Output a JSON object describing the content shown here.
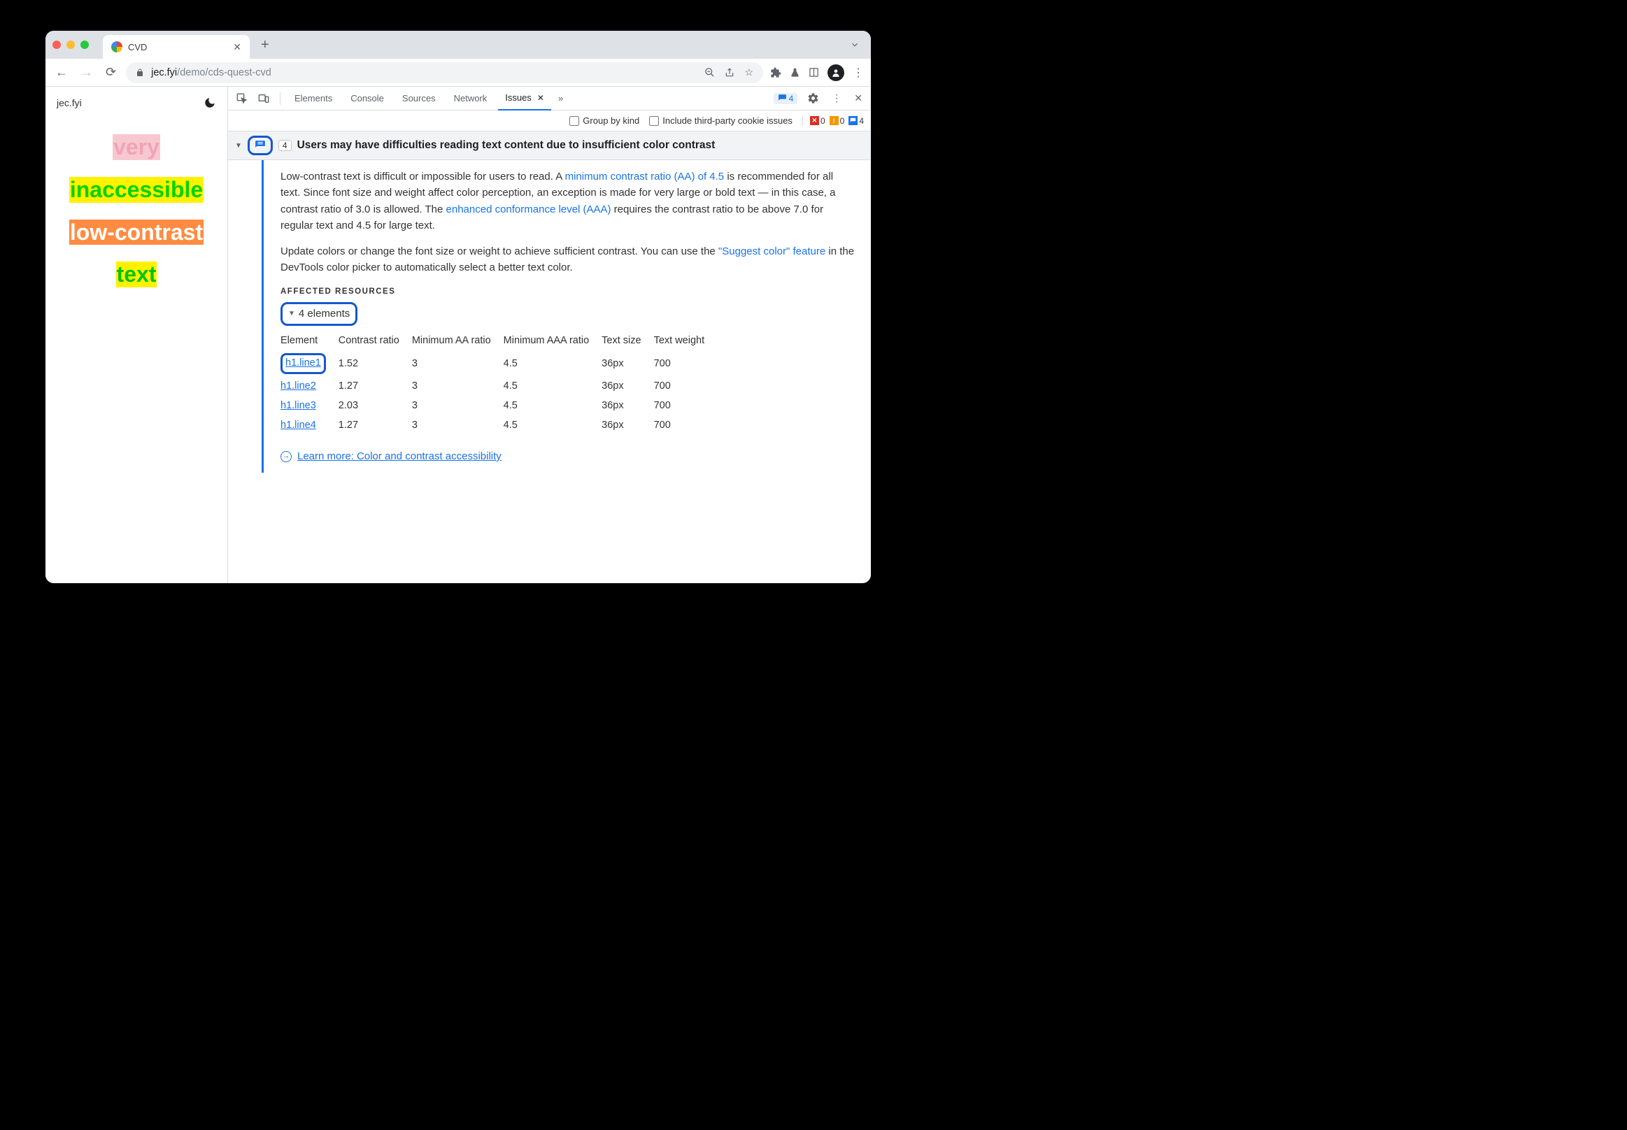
{
  "tab": {
    "title": "CVD"
  },
  "url": {
    "host": "jec.fyi",
    "path": "/demo/cds-quest-cvd"
  },
  "page": {
    "siteLabel": "jec.fyi",
    "samples": [
      "very",
      "inaccessible",
      "low-contrast",
      "text"
    ]
  },
  "devtools": {
    "tabs": [
      "Elements",
      "Console",
      "Sources",
      "Network",
      "Issues"
    ],
    "activeTab": "Issues",
    "msgBadge": "4",
    "filters": {
      "groupByKind": "Group by kind",
      "thirdParty": "Include third-party cookie issues"
    },
    "counts": {
      "errors": "0",
      "warnings": "0",
      "info": "4"
    }
  },
  "issue": {
    "count": "4",
    "title": "Users may have difficulties reading text content due to insufficient color contrast",
    "p1a": "Low-contrast text is difficult or impossible for users to read. A ",
    "p1link1": "minimum contrast ratio (AA) of 4.5",
    "p1b": " is recommended for all text. Since font size and weight affect color perception, an exception is made for very large or bold text — in this case, a contrast ratio of 3.0 is allowed. The ",
    "p1link2": "enhanced conformance level (AAA)",
    "p1c": " requires the contrast ratio to be above 7.0 for regular text and 4.5 for large text.",
    "p2a": "Update colors or change the font size or weight to achieve sufficient contrast. You can use the ",
    "p2link": "\"Suggest color\" feature",
    "p2b": " in the DevTools color picker to automatically select a better text color.",
    "affectedLabel": "AFFECTED RESOURCES",
    "elementsHeader": "4 elements",
    "columns": [
      "Element",
      "Contrast ratio",
      "Minimum AA ratio",
      "Minimum AAA ratio",
      "Text size",
      "Text weight"
    ],
    "rows": [
      {
        "el": "h1.line1",
        "cr": "1.52",
        "aa": "3",
        "aaa": "4.5",
        "size": "36px",
        "weight": "700"
      },
      {
        "el": "h1.line2",
        "cr": "1.27",
        "aa": "3",
        "aaa": "4.5",
        "size": "36px",
        "weight": "700"
      },
      {
        "el": "h1.line3",
        "cr": "2.03",
        "aa": "3",
        "aaa": "4.5",
        "size": "36px",
        "weight": "700"
      },
      {
        "el": "h1.line4",
        "cr": "1.27",
        "aa": "3",
        "aaa": "4.5",
        "size": "36px",
        "weight": "700"
      }
    ],
    "learnMore": "Learn more: Color and contrast accessibility"
  }
}
